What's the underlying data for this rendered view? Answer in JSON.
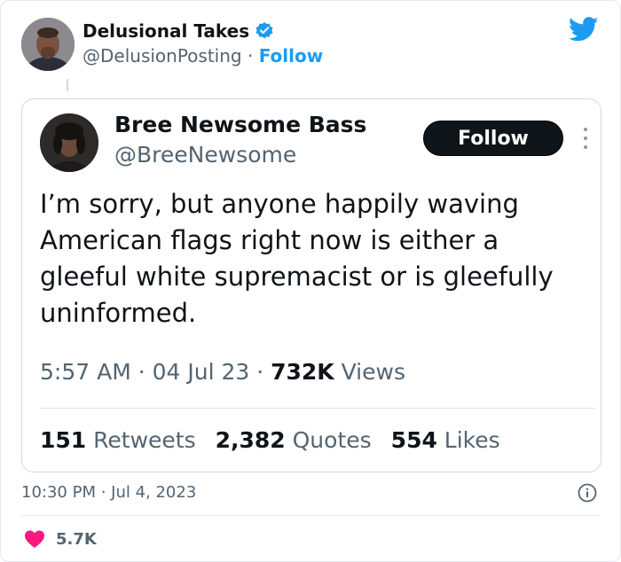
{
  "outer": {
    "display_name": "Delusional Takes",
    "handle": "@DelusionPosting",
    "separator": " · ",
    "follow_label": "Follow",
    "timestamp": "10:30 PM · Jul 4, 2023",
    "likes_count": "5.7K"
  },
  "quoted": {
    "display_name": "Bree Newsome Bass",
    "handle": "@BreeNewsome",
    "follow_label": "Follow",
    "text": "I’m sorry, but anyone happily waving American flags right now is either a gleeful white supremacist or is gleefully uninformed.",
    "time": "5:57 AM · 04 Jul 23 · ",
    "views_count": "732K",
    "views_label": " Views",
    "retweets_count": "151",
    "retweets_label": " Retweets",
    "quotes_count": "2,382",
    "quotes_label": " Quotes",
    "likes_count": "554",
    "likes_label": " Likes"
  },
  "icons": {
    "verified": "verified-badge-icon",
    "brand": "twitter-bird-icon",
    "more": "more-options-icon",
    "info": "info-icon",
    "like": "heart-icon"
  },
  "colors": {
    "accent": "#1d9bf0",
    "heart": "#f91880",
    "text": "#0f1419",
    "muted": "#536471"
  }
}
